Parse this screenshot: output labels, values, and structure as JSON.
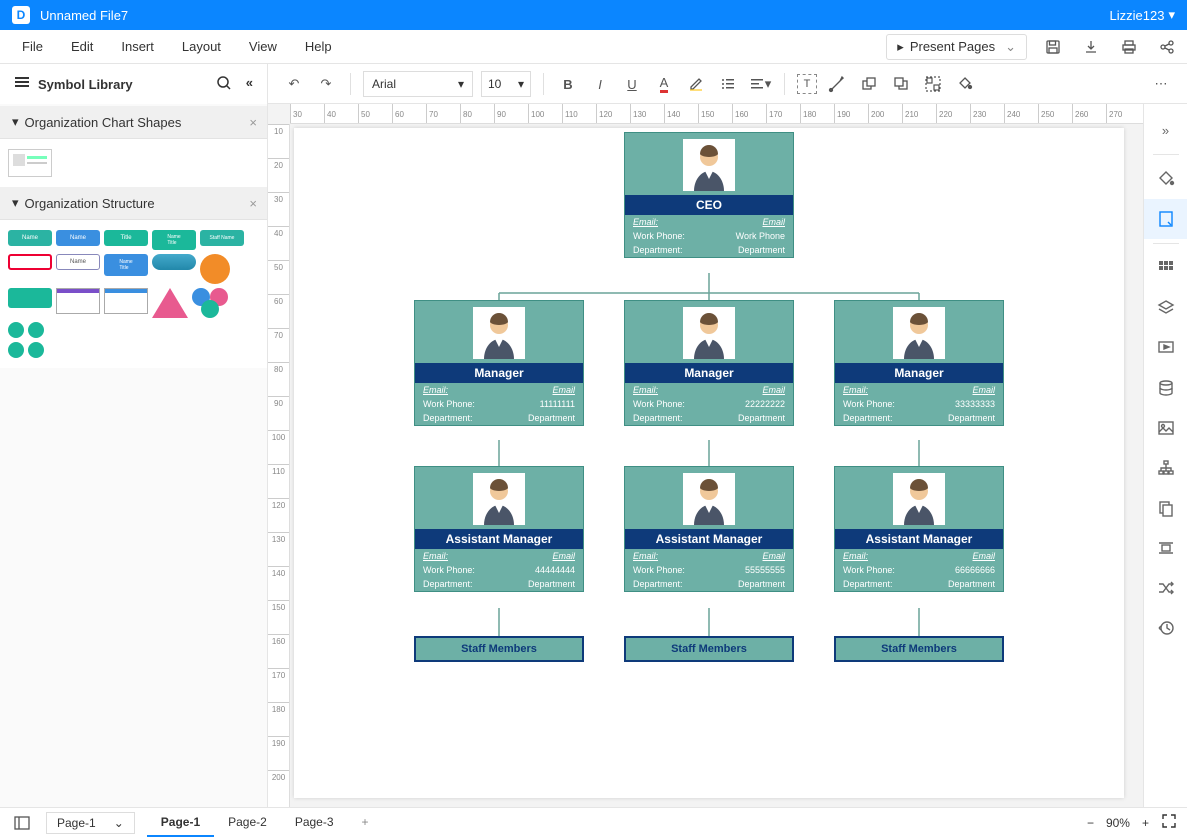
{
  "titlebar": {
    "filename": "Unnamed File7",
    "user": "Lizzie123"
  },
  "menu": {
    "file": "File",
    "edit": "Edit",
    "insert": "Insert",
    "layout": "Layout",
    "view": "View",
    "help": "Help",
    "present": "Present Pages"
  },
  "toolbar": {
    "font": "Arial",
    "fontsize": "10"
  },
  "sidebar": {
    "library_title": "Symbol Library",
    "section1": "Organization Chart Shapes",
    "section2": "Organization Structure"
  },
  "pages": {
    "p1": "Page-1",
    "p2": "Page-2",
    "p3": "Page-3",
    "select": "Page-1"
  },
  "status": {
    "zoom": "90%"
  },
  "labels": {
    "email": "Email:",
    "email_r": "Email",
    "workphone": "Work Phone:",
    "workphone_r": "Work Phone",
    "department": "Department:",
    "department_r": "Department",
    "staff": "Staff Members"
  },
  "org": {
    "ceo": {
      "title": "CEO",
      "phone": ""
    },
    "m1": {
      "title": "Manager",
      "phone": "11111111"
    },
    "m2": {
      "title": "Manager",
      "phone": "22222222"
    },
    "m3": {
      "title": "Manager",
      "phone": "33333333"
    },
    "a1": {
      "title": "Assistant Manager",
      "phone": "44444444"
    },
    "a2": {
      "title": "Assistant Manager",
      "phone": "55555555"
    },
    "a3": {
      "title": "Assistant Manager",
      "phone": "66666666"
    }
  },
  "ruler_h": [
    "30",
    "40",
    "50",
    "60",
    "70",
    "80",
    "90",
    "100",
    "110",
    "120",
    "130",
    "140",
    "150",
    "160",
    "170",
    "180",
    "190",
    "200",
    "210",
    "220",
    "230",
    "240",
    "250",
    "260",
    "270"
  ],
  "ruler_v": [
    "10",
    "20",
    "30",
    "40",
    "50",
    "60",
    "70",
    "80",
    "90",
    "100",
    "110",
    "120",
    "130",
    "140",
    "150",
    "160",
    "170",
    "180",
    "190",
    "200"
  ]
}
